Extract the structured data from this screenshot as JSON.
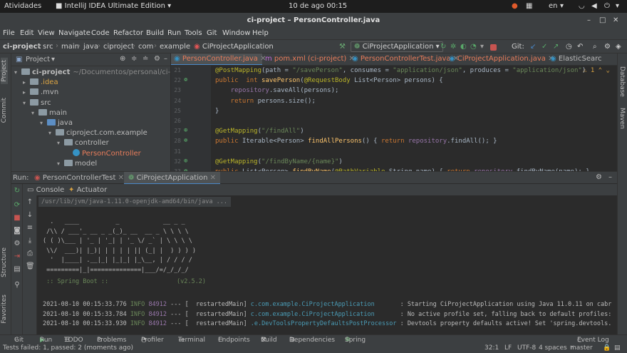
{
  "gnome_bar": {
    "activities": "Atividades",
    "app_name": "IntelliJ IDEA Ultimate Edition",
    "datetime": "10 de ago  00:15",
    "lang": "en"
  },
  "window": {
    "title": "ci-project – PersonController.java"
  },
  "menu": [
    "File",
    "Edit",
    "View",
    "Navigate",
    "Code",
    "Refactor",
    "Build",
    "Run",
    "Tools",
    "Git",
    "Window",
    "Help"
  ],
  "breadcrumb": [
    "ci-project",
    "src",
    "main",
    "java",
    "ciproject",
    "com",
    "example",
    "CiProjectApplication"
  ],
  "run_config": "CiProjectApplication",
  "git_label": "Git:",
  "project_panel": {
    "title": "Project",
    "tree": [
      {
        "label": "ci-project",
        "suffix": "~/Documentos/personal/ci-project",
        "depth": 0,
        "open": true,
        "type": "module"
      },
      {
        "label": ".idea",
        "depth": 1,
        "open": false,
        "type": "folder"
      },
      {
        "label": ".mvn",
        "depth": 1,
        "open": false,
        "type": "folder"
      },
      {
        "label": "src",
        "depth": 1,
        "open": true,
        "type": "folder"
      },
      {
        "label": "main",
        "depth": 2,
        "open": true,
        "type": "folder"
      },
      {
        "label": "java",
        "depth": 3,
        "open": true,
        "type": "blue"
      },
      {
        "label": "ciproject.com.example",
        "depth": 4,
        "open": true,
        "type": "pkg"
      },
      {
        "label": "controller",
        "depth": 5,
        "open": true,
        "type": "pkg"
      },
      {
        "label": "PersonController",
        "depth": 6,
        "open": null,
        "type": "class"
      },
      {
        "label": "model",
        "depth": 5,
        "open": true,
        "type": "pkg"
      }
    ]
  },
  "editor_tabs": [
    {
      "label": "PersonController.java",
      "active": true
    },
    {
      "label": "pom.xml (ci-project)",
      "active": false
    },
    {
      "label": "PersonControllerTest.java",
      "active": false
    },
    {
      "label": "CiProjectApplication.java",
      "active": false
    },
    {
      "label": "ElasticSearc",
      "active": false
    }
  ],
  "code": {
    "warning_count": "1",
    "lines": [
      {
        "n": "21",
        "parts": [
          [
            "ann",
            "@PostMapping"
          ],
          [
            "",
            "(path = "
          ],
          [
            "str",
            "\"/savePerson\""
          ],
          [
            "",
            ", consumes = "
          ],
          [
            "str",
            "\"application/json\""
          ],
          [
            "",
            ", produces = "
          ],
          [
            "str",
            "\"application/json\""
          ],
          [
            "",
            ")"
          ]
        ]
      },
      {
        "n": "22",
        "parts": [
          [
            "kw",
            "public  int "
          ],
          [
            "fn",
            "savePerson"
          ],
          [
            "",
            "("
          ],
          [
            "ann",
            "@RequestBody"
          ],
          [
            "",
            " List<Person> persons) {"
          ]
        ]
      },
      {
        "n": "23",
        "parts": [
          [
            "",
            "    "
          ],
          [
            "fld",
            "repository"
          ],
          [
            "",
            ".saveAll(persons);"
          ]
        ]
      },
      {
        "n": "24",
        "parts": [
          [
            "kw",
            "    return "
          ],
          [
            "",
            "persons.size();"
          ]
        ]
      },
      {
        "n": "25",
        "parts": [
          [
            "",
            "}"
          ]
        ]
      },
      {
        "n": "26",
        "parts": [
          [
            "",
            ""
          ]
        ]
      },
      {
        "n": "27",
        "parts": [
          [
            "ann",
            "@GetMapping"
          ],
          [
            "",
            "("
          ],
          [
            "str",
            "\"/findAll\""
          ],
          [
            "",
            ")"
          ]
        ]
      },
      {
        "n": "28",
        "parts": [
          [
            "kw",
            "public "
          ],
          [
            "",
            "Iterable<Person> "
          ],
          [
            "fn",
            "findAllPersons"
          ],
          [
            "",
            "() { "
          ],
          [
            "kw",
            "return "
          ],
          [
            "fld",
            "repository"
          ],
          [
            "",
            ".findAll(); }"
          ]
        ]
      },
      {
        "n": "31",
        "parts": [
          [
            "",
            ""
          ]
        ]
      },
      {
        "n": "32",
        "parts": [
          [
            "ann",
            "@GetMapping"
          ],
          [
            "",
            "("
          ],
          [
            "str",
            "\"/findByName/{name}\""
          ],
          [
            "",
            ")"
          ]
        ]
      },
      {
        "n": "33",
        "parts": [
          [
            "kw",
            "public "
          ],
          [
            "",
            "List<Person> "
          ],
          [
            "fn",
            "findByName"
          ],
          [
            "",
            "("
          ],
          [
            "ann",
            "@PathVariable"
          ],
          [
            "",
            " String name) { "
          ],
          [
            "kw",
            "return "
          ],
          [
            "fld",
            "repository"
          ],
          [
            "",
            ".findByName(name); }"
          ]
        ]
      }
    ]
  },
  "run_panel": {
    "label": "Run:",
    "tabs": [
      "PersonControllerTest",
      "CiProjectApplication"
    ],
    "console_tabs": [
      "Console",
      "Actuator"
    ],
    "java_cmd": "/usr/lib/jvm/java-1.11.0-openjdk-amd64/bin/java ...",
    "banner": [
      "  .   ____          _            __ _ _",
      " /\\\\ / ___'_ __ _ _(_)_ __  __ _ \\ \\ \\ \\",
      "( ( )\\___ | '_ | '_| | '_ \\/ _` | \\ \\ \\ \\",
      " \\\\/  ___)| |_)| | | | | || (_| |  ) ) ) )",
      "  '  |____| .__|_| |_|_| |_\\__, | / / / /",
      " =========|_|==============|___/=/_/_/_/"
    ],
    "spring_boot_label": " :: Spring Boot ::",
    "spring_boot_version": "(v2.5.2)",
    "logs": [
      {
        "ts": "2021-08-10 00:15:33.776",
        "level": "INFO",
        "pid": "84912",
        "thread": "--- [  restartedMain]",
        "logger": "c.com.example.CiProjectApplication      ",
        "msg": ": Starting CiProjectApplication using Java 11.0.11 on cabr"
      },
      {
        "ts": "2021-08-10 00:15:33.784",
        "level": "INFO",
        "pid": "84912",
        "thread": "--- [  restartedMain]",
        "logger": "c.com.example.CiProjectApplication      ",
        "msg": ": No active profile set, falling back to default profiles:"
      },
      {
        "ts": "2021-08-10 00:15:33.930",
        "level": "INFO",
        "pid": "84912",
        "thread": "--- [  restartedMain]",
        "logger": ".e.DevToolsPropertyDefaultsPostProcessor",
        "msg": ": Devtools property defaults active! Set 'spring.devtools."
      }
    ]
  },
  "bottom_tools": [
    "Git",
    "Run",
    "TODO",
    "Problems",
    "Profiler",
    "Terminal",
    "Endpoints",
    "Build",
    "Dependencies",
    "Spring",
    "Event Log"
  ],
  "status": {
    "message": "Tests failed: 1, passed: 2 (moments ago)",
    "position": "32:1",
    "line_sep": "LF",
    "encoding": "UTF-8",
    "indent": "4 spaces",
    "branch": "master"
  },
  "side_labels": {
    "left": [
      "Project",
      "Commit",
      "Structure",
      "Favorites"
    ],
    "right": [
      "Database",
      "Maven"
    ]
  },
  "colors": {
    "accent": "#4a88c7",
    "keyword": "#cc7832",
    "annotation": "#bbb529",
    "string": "#6a8759",
    "link": "#287bde"
  }
}
